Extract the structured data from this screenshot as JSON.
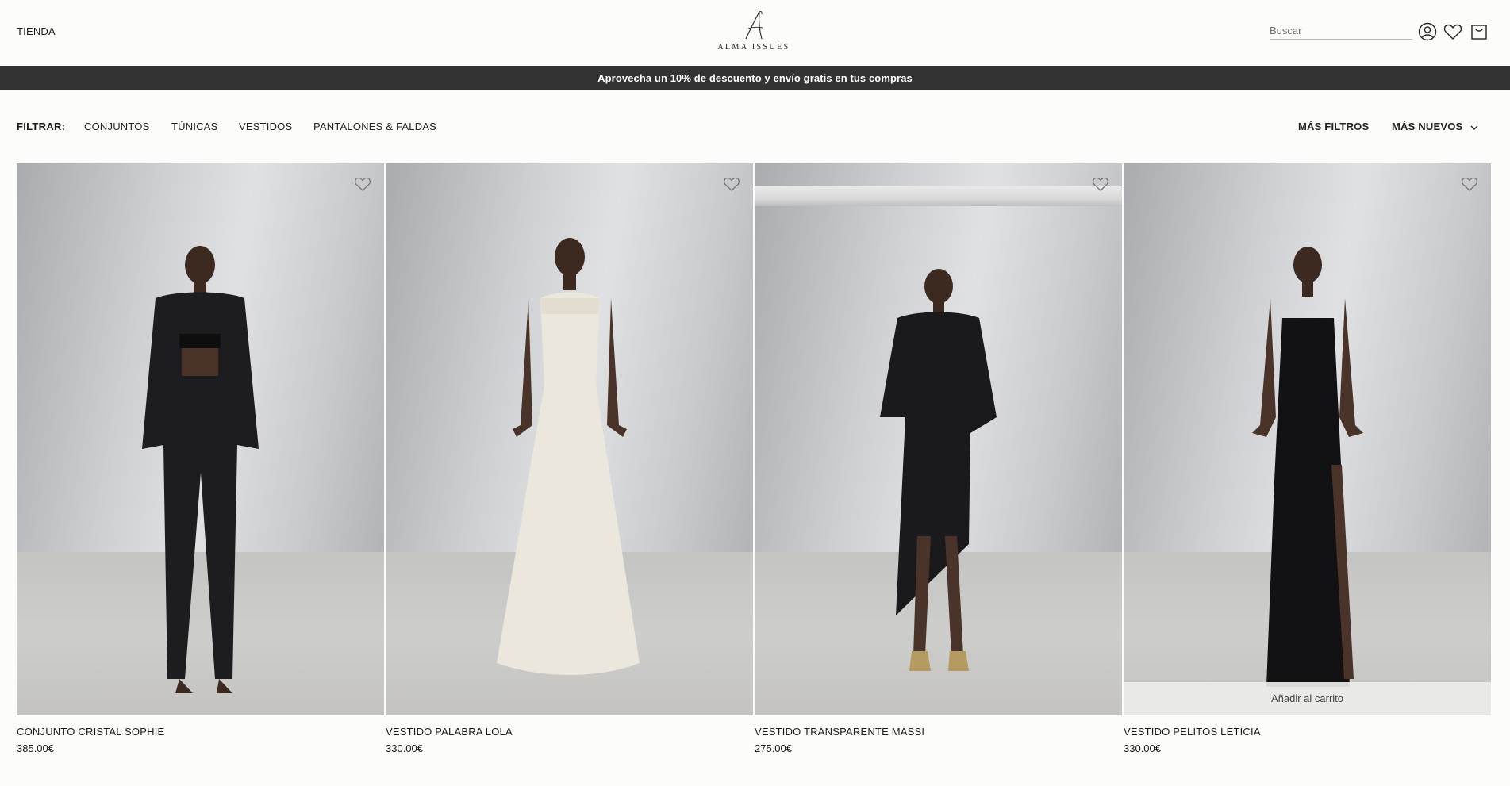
{
  "header": {
    "shop_label": "TIENDA",
    "logo_text": "ALMA ISSUES",
    "search_placeholder": "Buscar"
  },
  "banner": {
    "text": "Aprovecha un 10% de descuento y envío gratis en tus compras"
  },
  "filters": {
    "label": "FILTRAR:",
    "items": [
      "CONJUNTOS",
      "TÚNICAS",
      "VESTIDOS",
      "PANTALONES & FALDAS"
    ],
    "more_filters": "MÁS FILTROS",
    "sort": "MÁS NUEVOS"
  },
  "products": [
    {
      "name": "CONJUNTO CRISTAL SOPHIE",
      "price": "385.00€"
    },
    {
      "name": "VESTIDO PALABRA LOLA",
      "price": "330.00€"
    },
    {
      "name": "VESTIDO TRANSPARENTE MASSI",
      "price": "275.00€"
    },
    {
      "name": "VESTIDO PELITOS LETICIA",
      "price": "330.00€",
      "add_to_cart": "Añadir al carrito"
    }
  ],
  "colors": {
    "banner_bg": "#333333",
    "page_bg": "#fcfcfa",
    "text": "#1a1a1a"
  }
}
